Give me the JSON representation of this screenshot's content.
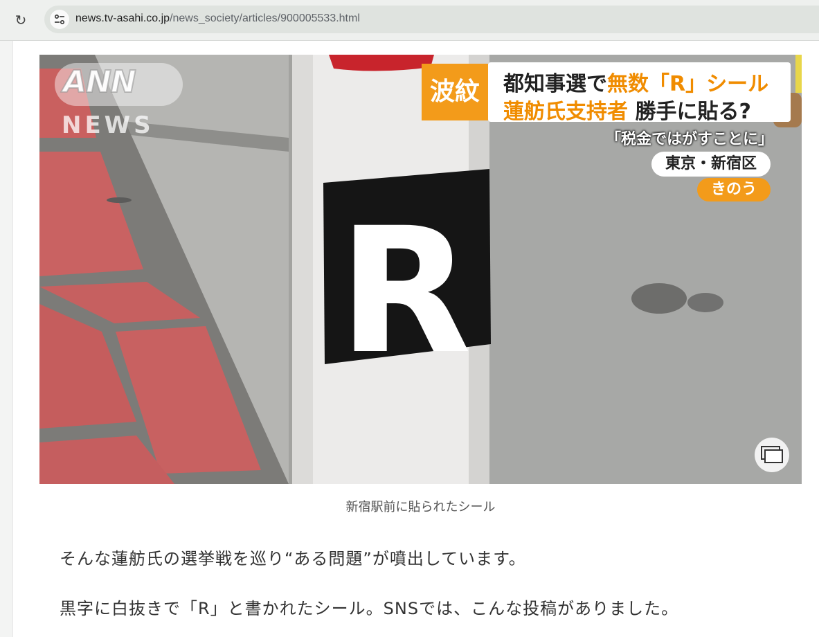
{
  "browser": {
    "url_domain": "news.tv-asahi.co.jp",
    "url_path": "/news_society/articles/900005533.html",
    "reload_icon": "reload-icon",
    "site_info_icon": "tune-icon"
  },
  "image_overlay": {
    "logo_top": "ANN",
    "logo_bottom": "NEWS",
    "corner_tag": "波紋",
    "headline_line1_a": "都知事選で",
    "headline_line1_b": "無数「R」シール",
    "headline_line2_a": "蓮舫氏支持者",
    "headline_line2_b": " 勝手に貼る?",
    "quote": "「税金ではがすことに」",
    "location": "東京・新宿区",
    "day": "きのう",
    "sticker_letter": "R",
    "pip_icon": "picture-in-picture-icon"
  },
  "article": {
    "caption": "新宿駅前に貼られたシール",
    "paragraph1": "そんな蓮舫氏の選挙戦を巡り“ある問題”が噴出しています。",
    "paragraph2": "黒字に白抜きで「R」と書かれたシール。SNSでは、こんな投稿がありました。"
  },
  "colors": {
    "accent_orange": "#f39b1a",
    "sticker_black": "#151515",
    "brick_red": "#c9605f"
  }
}
